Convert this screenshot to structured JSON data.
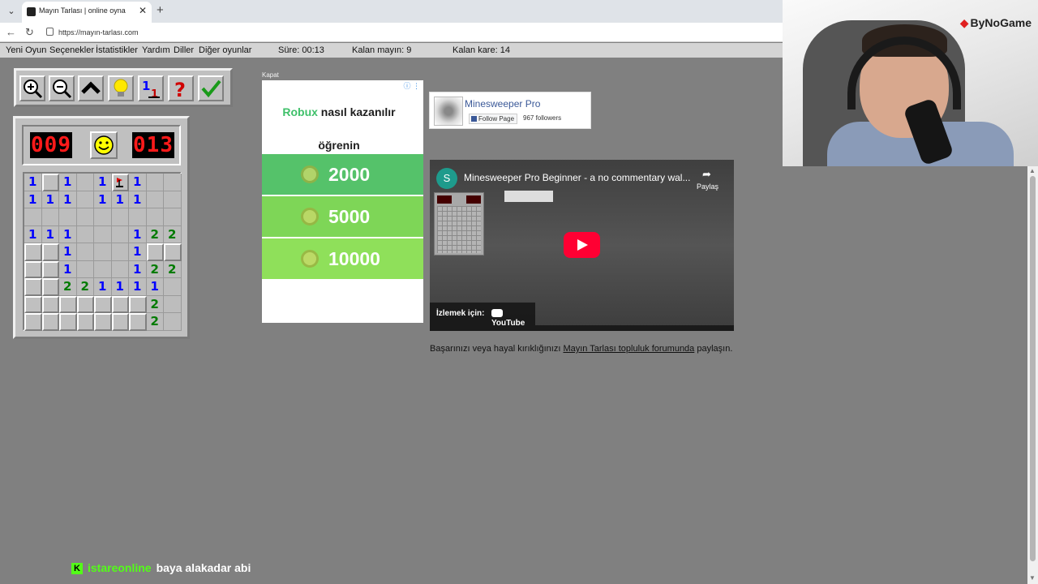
{
  "browser": {
    "tab_title": "Mayın Tarlası | online oyna",
    "tab_close": "✕",
    "new_tab": "+",
    "dropdown": "⌄",
    "back": "←",
    "reload": "↻",
    "url": "https://mayın-tarlası.com"
  },
  "menu": {
    "items": [
      "Yeni Oyun",
      "Seçenekler",
      "İstatistikler",
      "Yardım",
      "Diller",
      "Diğer oyunlar"
    ],
    "time": "Süre: 00:13",
    "mines_left": "Kalan mayın: 9",
    "squares_left": "Kalan kare: 14"
  },
  "toolbar": {
    "icons": [
      "zoom-in-icon",
      "zoom-out-icon",
      "chevron-up-icon",
      "lightbulb-icon",
      "numbers-icon",
      "help-icon",
      "check-icon"
    ]
  },
  "game": {
    "mines_counter": "009",
    "timer": "013",
    "board": [
      [
        "1",
        ".",
        "1",
        " ",
        "1",
        "F",
        "1",
        " ",
        " "
      ],
      [
        "1",
        "1",
        "1",
        " ",
        "1",
        "1",
        "1",
        " ",
        " "
      ],
      [
        " ",
        " ",
        " ",
        " ",
        " ",
        " ",
        " ",
        " ",
        " "
      ],
      [
        "1",
        "1",
        "1",
        " ",
        " ",
        " ",
        "1",
        "2",
        "2"
      ],
      [
        ".",
        ".",
        "1",
        " ",
        " ",
        " ",
        "1",
        ".",
        "."
      ],
      [
        ".",
        ".",
        "1",
        " ",
        " ",
        " ",
        "1",
        "2",
        "2"
      ],
      [
        ".",
        ".",
        "2",
        "2",
        "1",
        "1",
        "1",
        "1",
        " "
      ],
      [
        ".",
        ".",
        ".",
        ".",
        ".",
        ".",
        ".",
        "2",
        " "
      ],
      [
        ".",
        ".",
        ".",
        ".",
        ".",
        ".",
        ".",
        "2",
        " "
      ]
    ],
    "number_colors": {
      "1": "#0000ff",
      "2": "#007b00"
    }
  },
  "ad": {
    "close_label": "Kapat",
    "info": "ⓘ ⋮",
    "brand": "Robux",
    "line1_rest": " nasıl kazanılır",
    "line2": "öğrenin",
    "amounts": [
      "2000",
      "5000",
      "10000"
    ],
    "row_colors": [
      "#55c26a",
      "#7ed657",
      "#8fe05a"
    ]
  },
  "facebook": {
    "page_name": "Minesweeper Pro",
    "follow_label": "Follow Page",
    "followers": "967 followers"
  },
  "video": {
    "channel_initial": "S",
    "title": "Minesweeper Pro Beginner - a no commentary wal...",
    "share_label": "Paylaş",
    "watch_on": "İzlemek için:",
    "youtube": "YouTube"
  },
  "share_line": {
    "before": "Başarınızı veya hayal kırıklığınızı ",
    "link": "Mayın Tarlası topluluk forumunda",
    "after": " paylaşın."
  },
  "webcam": {
    "brand": "ByNoGame"
  },
  "chat": {
    "badge": "K",
    "user": "istareonline",
    "text": "baya alakadar abi"
  }
}
